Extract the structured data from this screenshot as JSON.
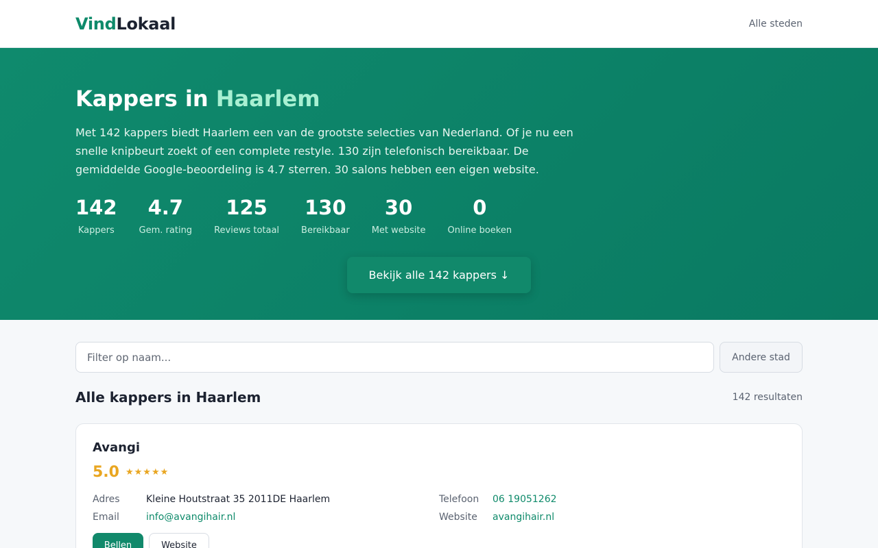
{
  "header": {
    "logo_part1": "Vind",
    "logo_part2": "Lokaal",
    "nav_all_cities": "Alle steden"
  },
  "hero": {
    "title_prefix": "Kappers in ",
    "title_city": "Haarlem",
    "intro": "Met 142 kappers biedt Haarlem een van de grootste selecties van Nederland. Of je nu een snelle knipbeurt zoekt of een complete restyle. 130 zijn telefonisch bereikbaar. De gemiddelde Google-beoordeling is 4.7 sterren. 30 salons hebben een eigen website.",
    "stats": [
      {
        "value": "142",
        "label": "Kappers"
      },
      {
        "value": "4.7",
        "label": "Gem. rating"
      },
      {
        "value": "125",
        "label": "Reviews totaal"
      },
      {
        "value": "130",
        "label": "Bereikbaar"
      },
      {
        "value": "30",
        "label": "Met website"
      },
      {
        "value": "0",
        "label": "Online boeken"
      }
    ],
    "cta_label": "Bekijk alle 142 kappers ↓"
  },
  "search": {
    "placeholder": "Filter op naam...",
    "value": "",
    "other_city_label": "Andere stad"
  },
  "results": {
    "heading": "Alle kappers in Haarlem",
    "count_text": "142 resultaten",
    "listings": [
      {
        "name": "Avangi",
        "rating": "5.0",
        "stars": "★★★★★",
        "address_label": "Adres",
        "address": "Kleine Houtstraat 35 2011DE Haarlem",
        "email_label": "Email",
        "email": "info@avangihair.nl",
        "phone_label": "Telefoon",
        "phone": "06 19051262",
        "website_label": "Website",
        "website": "avangihair.nl",
        "call_label": "Bellen",
        "site_button_label": "Website"
      }
    ]
  },
  "colors": {
    "brand": "#0e8a6a",
    "hero_bg": "#0f8a6d",
    "star": "#e9a621"
  }
}
